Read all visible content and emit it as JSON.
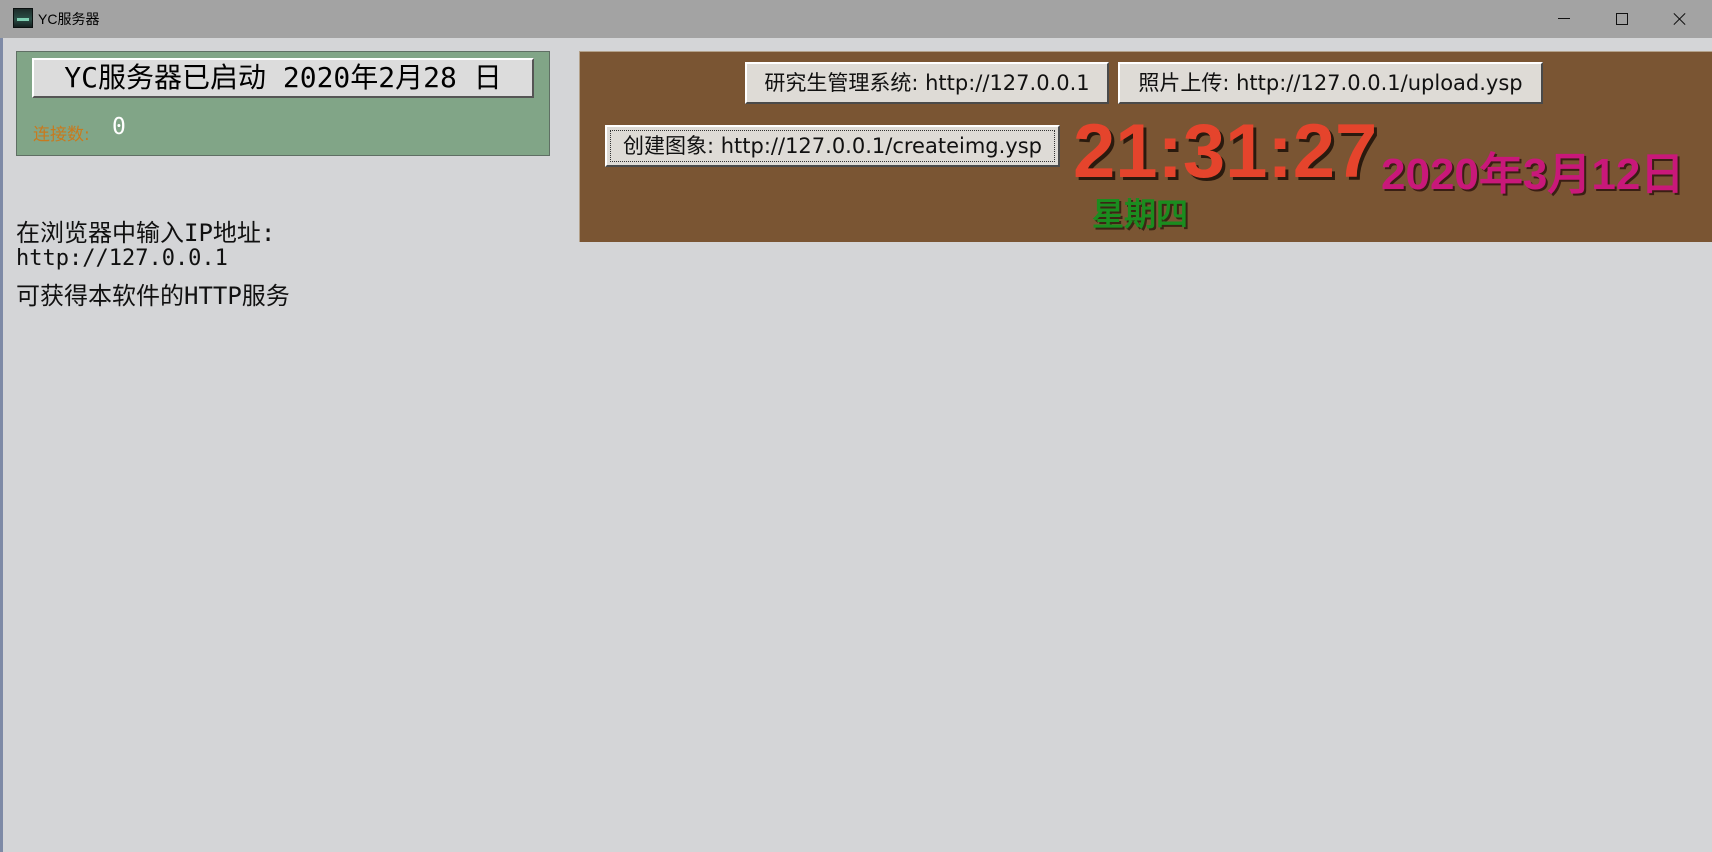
{
  "window": {
    "title": "YC服务器",
    "app_icon": "app-icon",
    "controls": {
      "minimize_icon": "minimize-icon",
      "maximize_icon": "maximize-icon",
      "close_icon": "close-icon"
    }
  },
  "status_panel": {
    "status_button_label": "YC服务器已启动 2020年2月28 日",
    "connections_label": "连接数:",
    "connections_value": "0",
    "background": "#81a587"
  },
  "info": {
    "line1": "在浏览器中输入IP地址:",
    "line2": "http://127.0.0.1",
    "line3": "可获得本软件的HTTP服务"
  },
  "clock_panel": {
    "background": "#7a5533",
    "buttons": {
      "grad_system": "研究生管理系统: http://127.0.0.1",
      "photo_upload": "照片上传: http://127.0.0.1/upload.ysp",
      "create_image": "创建图象: http://127.0.0.1/createimg.ysp"
    },
    "time": "21:31:27",
    "date": "2020年3月12日",
    "weekday": "星期四",
    "colors": {
      "time": "#e5442c",
      "date": "#c9187a",
      "weekday": "#1b8c1f"
    }
  }
}
